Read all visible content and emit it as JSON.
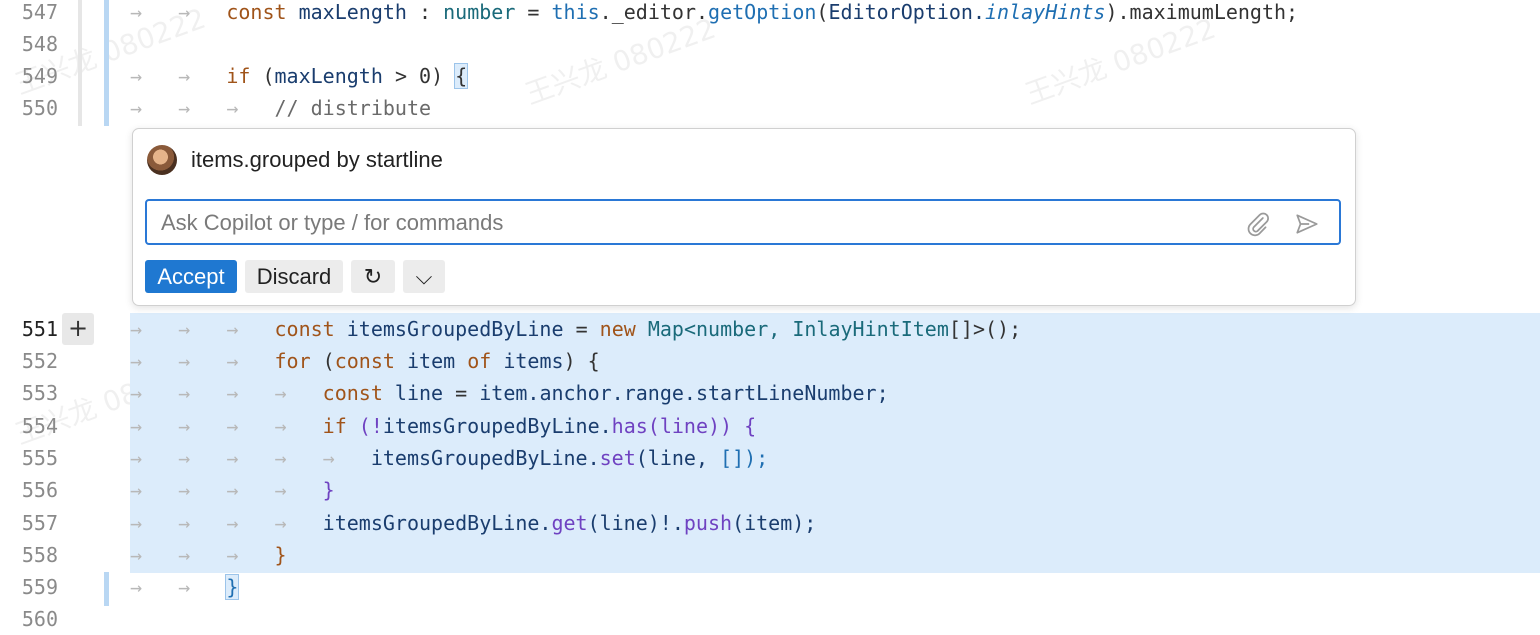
{
  "editor": {
    "line_numbers": [
      "547",
      "548",
      "549",
      "550",
      "551",
      "552",
      "553",
      "554",
      "555",
      "556",
      "557",
      "558",
      "559",
      "560"
    ],
    "active_line": "551"
  },
  "code": {
    "l547": {
      "kw": "const",
      "name": "maxLength",
      "colon": ":",
      "type": "number",
      "eq": "=",
      "this": "this",
      "editor": "._editor.",
      "fn": "getOption",
      "open": "(",
      "enum": "EditorOption.",
      "prop": "inlayHints",
      "close": ")",
      "rest": ".maximumLength;"
    },
    "l549": {
      "kw": "if",
      "open": "(",
      "var": "maxLength",
      "op": ">",
      "num": "0",
      "close": ")",
      "brace": "{"
    },
    "l550": {
      "comment": "// distribute"
    },
    "l551": {
      "kw": "const",
      "var": "itemsGroupedByLine",
      "eq": "=",
      "new": "new",
      "map": "Map",
      "gen": "<number,",
      "type": "InlayHintItem",
      "rest": "[]>();"
    },
    "l552": {
      "kw": "for",
      "open": "(",
      "kw2": "const",
      "var": "item",
      "of": "of",
      "items": "items",
      "close": ")",
      "brace": "{"
    },
    "l553": {
      "kw": "const",
      "var": "line",
      "eq": "=",
      "rest": "item.anchor.range.startLineNumber;"
    },
    "l554": {
      "kw": "if",
      "open": "(!",
      "var": "itemsGroupedByLine.",
      "fn": "has",
      "args": "(line))",
      "brace": "{"
    },
    "l555": {
      "var": "itemsGroupedByLine.",
      "fn": "set",
      "args": "(line,",
      "arr": "[]);"
    },
    "l556": {
      "brace": "}"
    },
    "l557": {
      "var": "itemsGroupedByLine.",
      "fn": "get",
      "args": "(line)!.",
      "fn2": "push",
      "args2": "(item);"
    },
    "l558": {
      "brace": "}"
    },
    "l559": {
      "brace": "}"
    }
  },
  "chat": {
    "prompt": "items.grouped by startline",
    "input_placeholder": "Ask Copilot or type / for commands",
    "accept": "Accept",
    "discard": "Discard",
    "rerun_icon": "↻",
    "more_icon": "⌵",
    "attach_icon": "paperclip-icon",
    "send_icon": "send-icon"
  },
  "watermark": "王兴龙 080222"
}
